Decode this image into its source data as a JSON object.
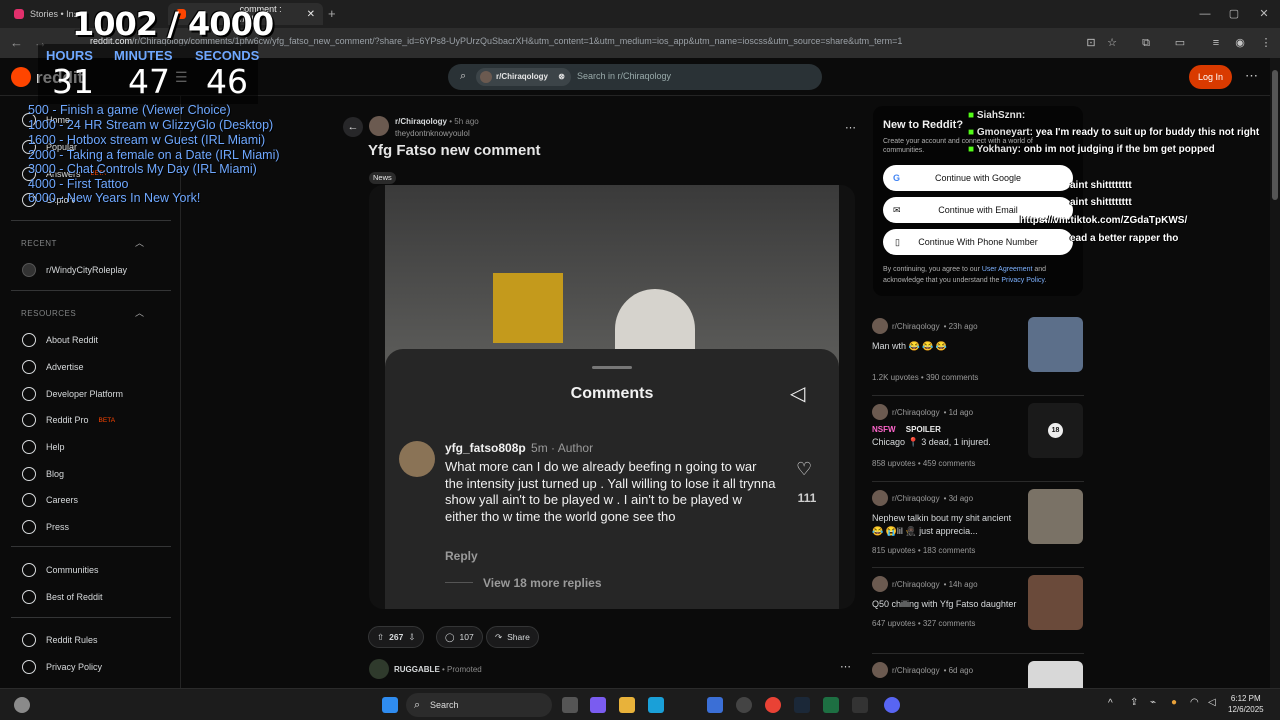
{
  "browser": {
    "tabs": [
      {
        "label": "Stories • Inst",
        "favicon_color": "#e1306c"
      },
      {
        "label": "comment : r/Chi",
        "favicon_color": "#ff4500"
      }
    ],
    "url_prefix": "reddit.com",
    "url_rest": "/r/Chiraqology/comments/1pfw6cw/yfg_fatso_new_comment/?share_id=6YPs8-UyPUrzQuSbacrXH&utm_content=1&utm_medium=ios_app&utm_name=ioscss&utm_source=share&utm_term=1"
  },
  "overlay": {
    "counter": "1002 / 4000",
    "timer": {
      "hours_label": "HOURS",
      "minutes_label": "MINUTES",
      "seconds_label": "SECONDS",
      "hours": "31",
      "minutes": "47",
      "seconds": "46"
    },
    "goals": [
      "500 -  Finish a game (Viewer Choice)",
      "1000 - 24 HR Stream w GlizzyGlo (Desktop)",
      "1600 - Hotbox stream w Guest (IRL Miami)",
      "2000 - Taking a female on a Date (IRL Miami)",
      "3000 - Chat Controls My Day (IRL Miami)",
      "4000 - First Tattoo",
      "6000 - New Years In New York!"
    ],
    "chat": [
      {
        "name": "SiahSznn:",
        "msg": ""
      },
      {
        "name": "Gmoneyart:",
        "msg": "yea I'm ready to suit up for buddy this not right"
      },
      {
        "name": "Yokhany:",
        "msg": "onb im not judging if the bm get popped"
      },
      {
        "name": "",
        "msg": "aint shitttttttt"
      },
      {
        "name": "",
        "msg": "aint shitttttttt"
      },
      {
        "name": "",
        "msg": "https://vm.tiktok.com/ZGdaTpKWS/"
      },
      {
        "name": "",
        "msg": "ead a better rapper tho"
      }
    ]
  },
  "reddit": {
    "logo": "reddit",
    "search": {
      "chip": "r/Chiraqology",
      "placeholder": "Search in r/Chiraqology"
    },
    "login_label": "Log In",
    "sidebar": {
      "nav": [
        "Home",
        "Popular",
        "Answers",
        "Explore"
      ],
      "answers_badge": "BETA",
      "recent_header": "RECENT",
      "recent": [
        "r/WindyCityRoleplay"
      ],
      "resources_header": "RESOURCES",
      "resources": [
        "About Reddit",
        "Advertise",
        "Developer Platform",
        "Reddit Pro",
        "Help",
        "Blog",
        "Careers",
        "Press"
      ],
      "reddit_pro_badge": "BETA",
      "more": [
        "Communities",
        "Best of Reddit"
      ],
      "legal": [
        "Reddit Rules",
        "Privacy Policy"
      ]
    },
    "post": {
      "subreddit": "r/Chiraqology",
      "age": "• 5h ago",
      "author": "theydontnknowyoulol",
      "title": "Yfg Fatso new comment",
      "flair": "News",
      "embed": {
        "sheet_title": "Comments",
        "comment_user": "yfg_fatso808p",
        "comment_meta": "5m · Author",
        "comment_text": "What more can I do we already beefing n going to war the intensity just turned up . Yall willing to lose it all trynna show yall ain't to be played w . I ain't to be played w either tho w time the world gone see tho",
        "likes": "111",
        "reply": "Reply",
        "more_replies": "View 18 more replies"
      },
      "upvotes": "267",
      "comments": "107",
      "share": "Share"
    },
    "promoted": {
      "name": "RUGGABLE",
      "label": "Promoted"
    },
    "new_to_reddit": {
      "title": "New to Reddit?",
      "desc": "Create your account and connect with a world of communities.",
      "google": "Continue with Google",
      "email": "Continue with Email",
      "phone": "Continue With Phone Number",
      "legal_pre": "By continuing, you agree to our ",
      "agreement": "User Agreement",
      "legal_mid": " and acknowledge that you understand the ",
      "privacy": "Privacy Policy",
      "legal_end": "."
    },
    "feed": [
      {
        "sub": "r/Chiraqology",
        "age": "• 23h ago",
        "title": "Man wth 😂 😂 😂",
        "upvotes": "1.2K upvotes",
        "comments": "390 comments",
        "thumb_color": "#5c6f8a"
      },
      {
        "sub": "r/Chiraqology",
        "age": "• 1d ago",
        "nsfw": "NSFW",
        "spoiler": "SPOILER",
        "title": "Chicago 📍 3 dead, 1 injured.",
        "upvotes": "858 upvotes",
        "comments": "459 comments",
        "thumb_color": "#1a1a1a",
        "thumb_badge": "18"
      },
      {
        "sub": "r/Chiraqology",
        "age": "• 3d ago",
        "title": "Nephew talkin bout my shit ancient 😂 😭lil 🥷🏿 just apprecia...",
        "upvotes": "815 upvotes",
        "comments": "183 comments",
        "thumb_color": "#7a7266"
      },
      {
        "sub": "r/Chiraqology",
        "age": "• 14h ago",
        "title": "Q50 chilling with Yfg Fatso daughter",
        "upvotes": "647 upvotes",
        "comments": "327 comments",
        "thumb_color": "#6a4a3a"
      },
      {
        "sub": "r/Chiraqology",
        "age": "• 6d ago",
        "title": "",
        "upvotes": "",
        "comments": "",
        "thumb_color": "#d8d8d8"
      }
    ]
  },
  "taskbar": {
    "search": "Search",
    "time": "6:12 PM",
    "date": "12/6/2025"
  }
}
